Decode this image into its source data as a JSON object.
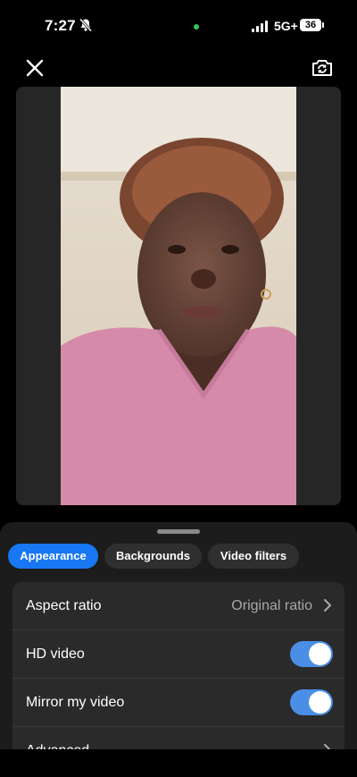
{
  "status": {
    "time": "7:27",
    "network": "5G+",
    "battery": "36"
  },
  "tabs": [
    {
      "label": "Appearance",
      "active": true
    },
    {
      "label": "Backgrounds",
      "active": false
    },
    {
      "label": "Video filters",
      "active": false
    }
  ],
  "settings": {
    "aspect_ratio": {
      "label": "Aspect ratio",
      "value": "Original ratio"
    },
    "hd_video": {
      "label": "HD video",
      "on": true
    },
    "mirror": {
      "label": "Mirror my video",
      "on": true
    },
    "advanced": {
      "label": "Advanced"
    }
  },
  "colors": {
    "accent": "#1877f2",
    "toggle_on": "#4a8ee6",
    "sheet_bg": "#1c1c1c",
    "card_bg": "#2a2a2a"
  }
}
